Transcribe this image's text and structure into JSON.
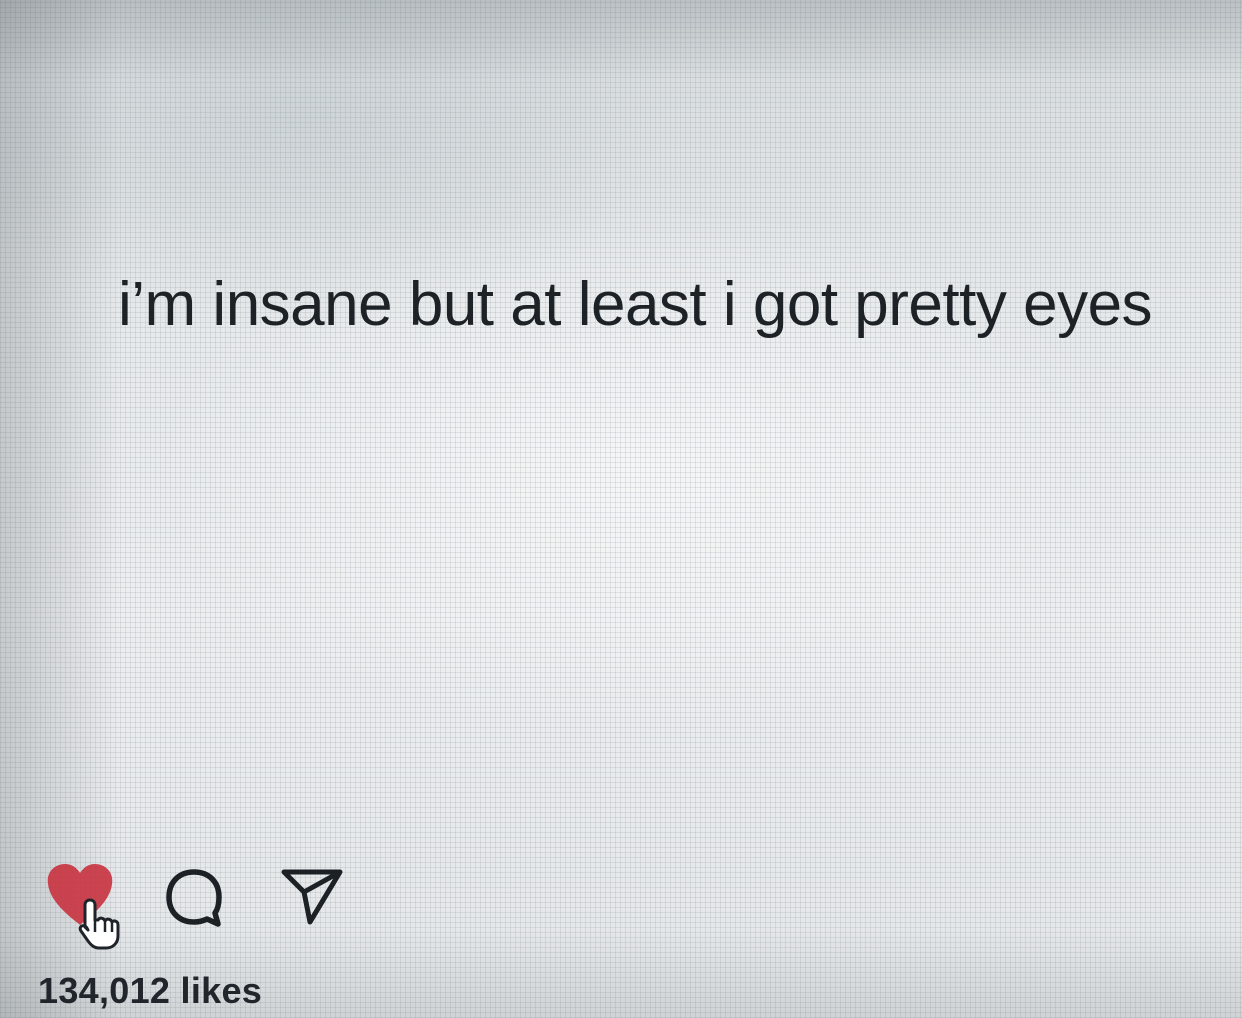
{
  "post": {
    "text": "i’m insane but at least i got pretty eyes"
  },
  "actions": {
    "like_icon": "heart-icon",
    "like_state": "liked",
    "like_color": "#c8323f",
    "cursor_icon": "hand-pointer-icon",
    "comment_icon": "speech-bubble-icon",
    "share_icon": "paper-plane-icon"
  },
  "likes": {
    "label": "134,012 likes"
  }
}
